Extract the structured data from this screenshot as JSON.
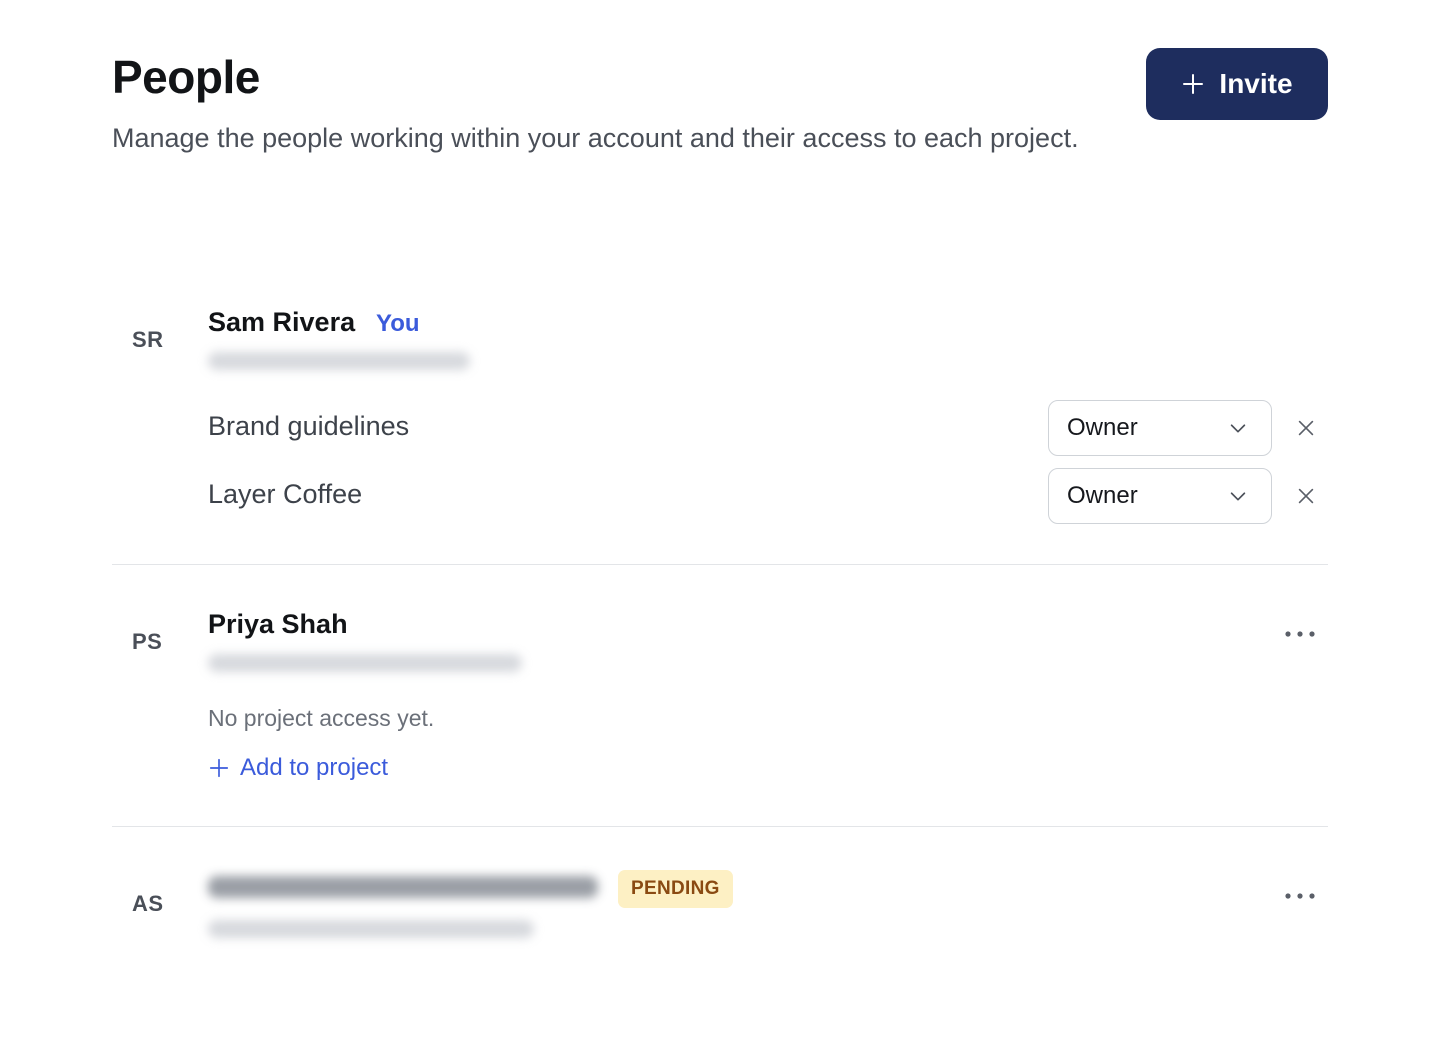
{
  "header": {
    "title": "People",
    "subtitle": "Manage the people working within your account and their access to each project.",
    "invite_label": "Invite"
  },
  "people": [
    {
      "initials": "SR",
      "name": "Sam Rivera",
      "tag": "You",
      "projects": [
        {
          "name": "Brand guidelines",
          "role": "Owner"
        },
        {
          "name": "Layer Coffee",
          "role": "Owner"
        }
      ]
    },
    {
      "initials": "PS",
      "name": "Priya Shah",
      "no_access_text": "No project access yet.",
      "add_link_label": "Add to project"
    },
    {
      "initials": "AS",
      "status": "PENDING"
    }
  ],
  "icons": {
    "invite": "plus-icon",
    "role_dropdown": "chevron-down-icon",
    "remove": "close-icon",
    "more": "more-horizontal-icon",
    "add": "plus-icon"
  },
  "colors": {
    "primary_button": "#1e2d5e",
    "link": "#3b5bdb",
    "pending_bg": "#fdf0c4",
    "pending_text": "#8a4a12"
  }
}
